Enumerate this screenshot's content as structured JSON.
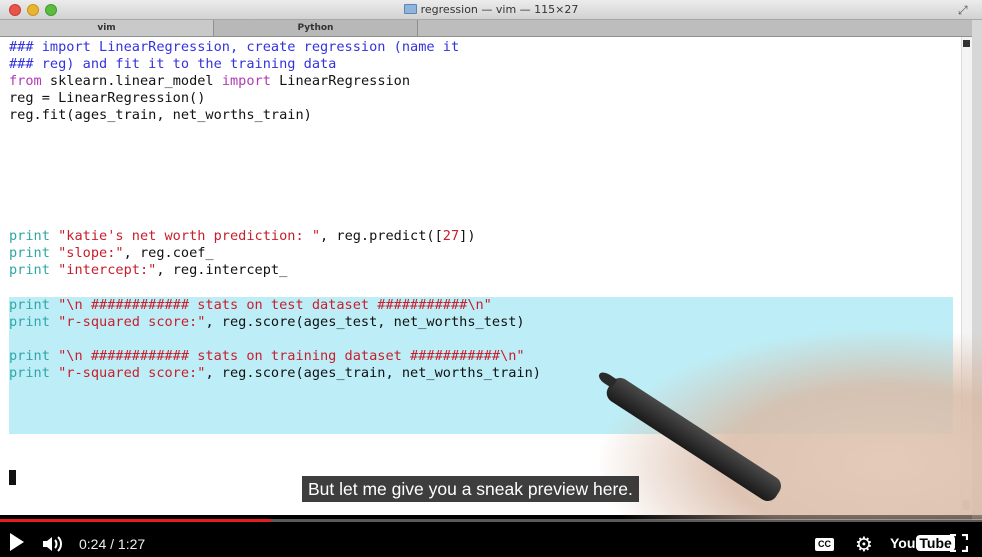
{
  "window": {
    "title": "regression — vim — 115×27"
  },
  "tabs": [
    {
      "label": "vim"
    },
    {
      "label": "Python"
    }
  ],
  "caption": "But let me give you a sneak preview here.",
  "player": {
    "time": "0:24 / 1:27",
    "progress_fraction": 0.276,
    "loaded_fraction": 0.264,
    "cc_label": "CC",
    "logo_you": "You",
    "logo_tube": "Tube"
  },
  "colors": {
    "comment": "#3333dd",
    "keyword": "#b13ab4",
    "print": "#2fa7a7",
    "string": "#c81e2b",
    "highlight": "#bdeef7",
    "progress": "#e31b23"
  },
  "code": {
    "l1": {
      "a": "### import LinearRegression, create regression (name it"
    },
    "l2": {
      "a": "### reg) and fit it to the training data"
    },
    "l3": {
      "a": "from",
      "b": " sklearn.linear_model ",
      "c": "import",
      "d": " LinearRegression"
    },
    "l4": {
      "a": "reg = LinearRegression()"
    },
    "l5": {
      "a": "reg.fit(ages_train, net_worths_train)"
    },
    "l6": {
      "a": "print",
      "b": " ",
      "c": "\"katie's net worth prediction: \"",
      "d": ", reg.predict([",
      "e": "27",
      "f": "])"
    },
    "l7": {
      "a": "print",
      "b": " ",
      "c": "\"slope:\"",
      "d": ", reg.coef_"
    },
    "l8": {
      "a": "print",
      "b": " ",
      "c": "\"intercept:\"",
      "d": ", reg.intercept_"
    },
    "l9": {
      "a": "print",
      "b": " ",
      "c": "\"\\n ############ stats on test dataset ###########\\n\""
    },
    "l10": {
      "a": "print",
      "b": " ",
      "c": "\"r-squared score:\"",
      "d": ", reg.score(ages_test, net_worths_test)"
    },
    "l11": {
      "a": "print",
      "b": " ",
      "c": "\"\\n ############ stats on training dataset ###########\\n\""
    },
    "l12": {
      "a": "print",
      "b": " ",
      "c": "\"r-squared score:\"",
      "d": ", reg.score(ages_train, net_worths_train)"
    }
  }
}
